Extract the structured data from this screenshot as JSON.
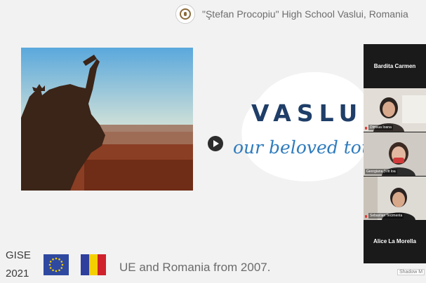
{
  "header": {
    "school_name": "\"Ştefan Procopiu\" High School Vaslui, Romania",
    "seal_icon": "school-seal-icon"
  },
  "slide": {
    "city": "VASLUI,",
    "slogan": "our beloved tou",
    "project_line1": "GISE",
    "project_line2": "2021",
    "caption": "UE and Romania from 2007."
  },
  "participants": [
    {
      "name": "Bardita Carmen",
      "video": false
    },
    {
      "name": "",
      "label": "Dimsua Ioana",
      "video": true
    },
    {
      "name": "",
      "label": "Georgiana (Vilt Ioa",
      "video": true
    },
    {
      "name": "",
      "label": "Sebastian Tecimenta",
      "video": true
    },
    {
      "name": "Alice La Morella",
      "video": false
    }
  ],
  "footer": {
    "tag": "Shadow M"
  },
  "colors": {
    "title": "#1f3e68",
    "slogan": "#2e7bbd",
    "eu_blue": "#2f49a0",
    "ro_blue": "#2e3f9e",
    "ro_yellow": "#f5d000",
    "ro_red": "#d0222d"
  }
}
